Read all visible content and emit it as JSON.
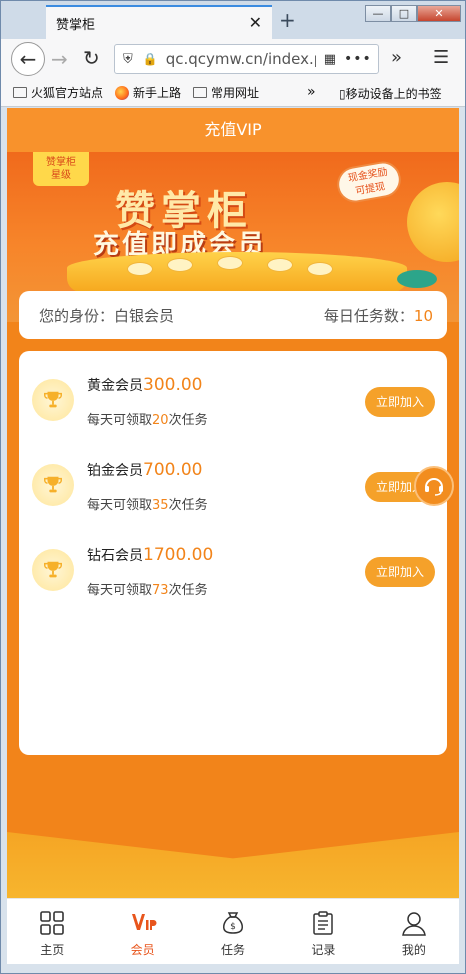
{
  "browser": {
    "tab_title": "赞掌柜",
    "tab_close": "✕",
    "new_tab": "+",
    "url": "qc.qcymw.cn/index.php",
    "bookmarks": [
      "火狐官方站点",
      "新手上路",
      "常用网址"
    ],
    "bookmarks_overflow": "»",
    "mobile_bookmarks": "移动设备上的书签"
  },
  "page": {
    "title": "充值VIP"
  },
  "banner": {
    "badge_line1": "赞掌柜",
    "badge_line2": "星级",
    "title": "赞掌柜",
    "subtitle": "充值即成会员",
    "tag_line1": "现金奖励",
    "tag_line2": "可提现"
  },
  "identity": {
    "label": "您的身份：白银会员",
    "tasks_label": "每日任务数：",
    "tasks_value": "10"
  },
  "vip": {
    "items": [
      {
        "name": "黄金会员",
        "price": "300.00",
        "desc_prefix": "每天可领取",
        "count": "20",
        "desc_suffix": "次任务",
        "button": "立即加入"
      },
      {
        "name": "铂金会员",
        "price": "700.00",
        "desc_prefix": "每天可领取",
        "count": "35",
        "desc_suffix": "次任务",
        "button": "立即加入"
      },
      {
        "name": "钻石会员",
        "price": "1700.00",
        "desc_prefix": "每天可领取",
        "count": "73",
        "desc_suffix": "次任务",
        "button": "立即加入"
      }
    ]
  },
  "nav": {
    "items": [
      {
        "label": "主页",
        "icon": "grid-icon"
      },
      {
        "label": "会员",
        "icon": "vip-icon"
      },
      {
        "label": "任务",
        "icon": "money-bag-icon"
      },
      {
        "label": "记录",
        "icon": "clipboard-icon"
      },
      {
        "label": "我的",
        "icon": "user-icon"
      }
    ],
    "active": 1,
    "active_color": "#e8551c"
  },
  "colors": {
    "accent": "#f2841a",
    "button": "#f5a12a"
  }
}
